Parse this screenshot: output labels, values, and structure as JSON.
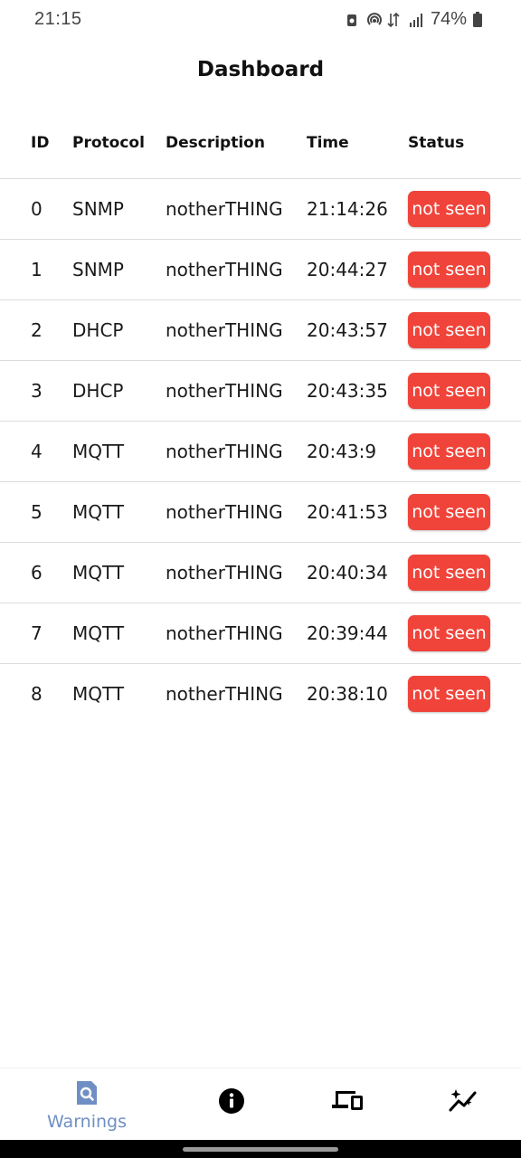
{
  "status_bar": {
    "time": "21:15",
    "battery": "74%",
    "icons": [
      "recycle-icon",
      "hotspot-icon",
      "data-transfer-icon",
      "signal-icon",
      "battery-icon"
    ]
  },
  "page": {
    "title": "Dashboard"
  },
  "table": {
    "headers": {
      "id": "ID",
      "protocol": "Protocol",
      "description": "Description",
      "time": "Time",
      "status": "Status"
    },
    "rows": [
      {
        "id": "0",
        "protocol": "SNMP",
        "description": "notherTHING",
        "time": "21:14:26",
        "status": "not seen"
      },
      {
        "id": "1",
        "protocol": "SNMP",
        "description": "notherTHING",
        "time": "20:44:27",
        "status": "not seen"
      },
      {
        "id": "2",
        "protocol": "DHCP",
        "description": "notherTHING",
        "time": "20:43:57",
        "status": "not seen"
      },
      {
        "id": "3",
        "protocol": "DHCP",
        "description": "notherTHING",
        "time": "20:43:35",
        "status": "not seen"
      },
      {
        "id": "4",
        "protocol": "MQTT",
        "description": "notherTHING",
        "time": "20:43:9",
        "status": "not seen"
      },
      {
        "id": "5",
        "protocol": "MQTT",
        "description": "notherTHING",
        "time": "20:41:53",
        "status": "not seen"
      },
      {
        "id": "6",
        "protocol": "MQTT",
        "description": "notherTHING",
        "time": "20:40:34",
        "status": "not seen"
      },
      {
        "id": "7",
        "protocol": "MQTT",
        "description": "notherTHING",
        "time": "20:39:44",
        "status": "not seen"
      },
      {
        "id": "8",
        "protocol": "MQTT",
        "description": "notherTHING",
        "time": "20:38:10",
        "status": "not seen"
      }
    ]
  },
  "bottom_nav": {
    "items": [
      {
        "label": "Warnings",
        "icon": "search-document-icon",
        "active": true
      },
      {
        "label": "",
        "icon": "info-icon",
        "active": false
      },
      {
        "label": "",
        "icon": "devices-icon",
        "active": false
      },
      {
        "label": "",
        "icon": "sparkle-chart-icon",
        "active": false
      }
    ]
  },
  "colors": {
    "status_not_seen": "#f0443a",
    "nav_active": "#6f8fc4"
  }
}
